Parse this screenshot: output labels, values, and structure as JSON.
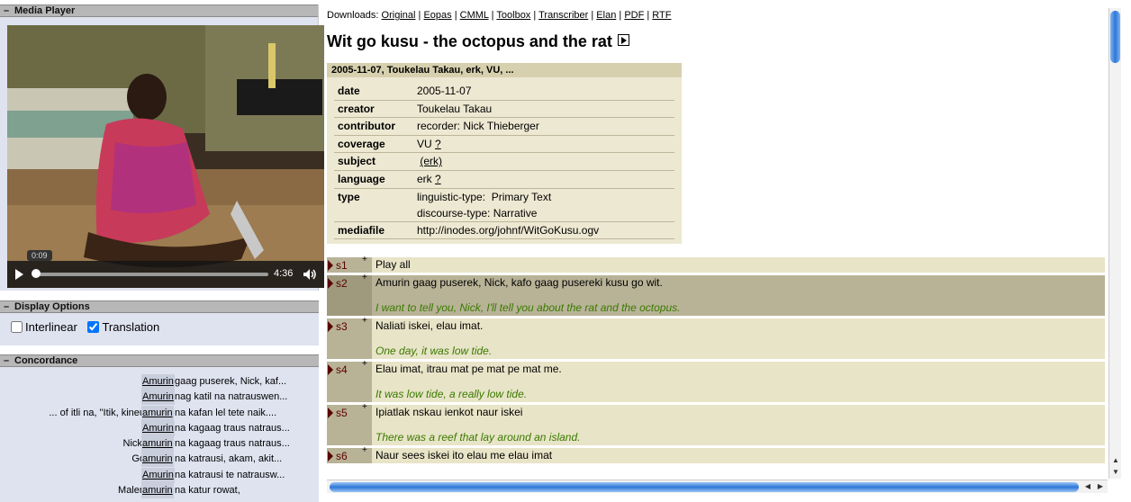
{
  "media_panel": {
    "title": "Media Player",
    "current_time": "0:09",
    "duration": "4:36",
    "progress": 0.033
  },
  "display_options": {
    "title": "Display Options",
    "interlinear_label": "Interlinear",
    "translation_label": "Translation",
    "interlinear_checked": false,
    "translation_checked": true
  },
  "concordance": {
    "title": "Concordance",
    "rows": [
      {
        "left": "",
        "keyword": "Amurin",
        "right": "gaag puserek, Nick, kaf..."
      },
      {
        "left": "",
        "keyword": "Amurin",
        "right": "nag katil na natrauswen..."
      },
      {
        "left": "... of itli na, \"Itik, kineu",
        "keyword": "amurin",
        "right": "na kafan lel tete naik...."
      },
      {
        "left": "",
        "keyword": "Amurin",
        "right": "na kagaag traus natraus..."
      },
      {
        "left": "Nick,",
        "keyword": "amurin",
        "right": "na kagaag traus natraus..."
      },
      {
        "left": "Go",
        "keyword": "amurin",
        "right": "na katrausi, akam, akit..."
      },
      {
        "left": "",
        "keyword": "Amurin",
        "right": "na katrausi te natrausw..."
      },
      {
        "left": "Malen",
        "keyword": "amurin",
        "right": "na katur rowat,"
      }
    ]
  },
  "downloads": {
    "label": "Downloads:",
    "links": [
      "Original",
      "Eopas",
      "CMML",
      "Toolbox",
      "Transcriber",
      "Elan",
      "PDF",
      "RTF"
    ]
  },
  "title": "Wit go kusu - the octopus and the rat",
  "metadata": {
    "header": "2005-11-07, Toukelau Takau, erk, VU, ...",
    "rows": [
      {
        "key": "date",
        "value": "2005-11-07"
      },
      {
        "key": "creator",
        "value": "Toukelau Takau"
      },
      {
        "key": "contributor",
        "value": "recorder: Nick Thieberger"
      },
      {
        "key": "coverage",
        "value": "VU",
        "link": "?"
      },
      {
        "key": "subject",
        "value": "",
        "link": "(erk)"
      },
      {
        "key": "language",
        "value": "erk",
        "link": "?"
      },
      {
        "key": "type",
        "value": "linguistic-type:  Primary Text",
        "value2": "discourse-type: Narrative"
      },
      {
        "key": "mediafile",
        "value": "http://inodes.org/johnf/WitGoKusu.ogv"
      }
    ]
  },
  "segments": [
    {
      "id": "s1",
      "text": "Play all",
      "translation": ""
    },
    {
      "id": "s2",
      "text": "Amurin gaag puserek, Nick, kafo gaag pusereki kusu go wit.",
      "translation": "I want to tell you, Nick, I'll tell you about the rat and the octopus."
    },
    {
      "id": "s3",
      "text": "Naliati iskei, elau imat.",
      "translation": "One day, it was low tide."
    },
    {
      "id": "s4",
      "text": "Elau imat, itrau mat pe mat pe mat me.",
      "translation": "It was low tide, a really low tide."
    },
    {
      "id": "s5",
      "text": "Ipiatlak nskau ienkot naur iskei",
      "translation": "There was a reef that lay around an island."
    },
    {
      "id": "s6",
      "text": "Naur sees iskei ito elau me elau imat",
      "translation": ""
    }
  ],
  "icons": {
    "play": "play-icon",
    "volume": "volume-icon",
    "segment_play": "segment-play-icon"
  }
}
